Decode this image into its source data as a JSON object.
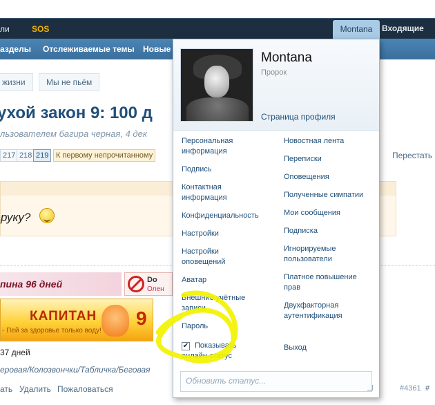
{
  "topbar": {
    "left_label": "ли",
    "sos_label": "SOS",
    "active_tab": "Montana",
    "right_tab": "Входящие"
  },
  "subnav": {
    "items": [
      "азделы",
      "Отслеживаемые темы",
      "Новые с"
    ]
  },
  "background": {
    "breadcrumbs": [
      "жизни",
      "Мы не пьём"
    ],
    "thread_title": "ухой закон 9: 100 д",
    "thread_author": "льзователем багира черная, 4 дек",
    "pages": [
      "217",
      "218",
      "219"
    ],
    "current_page": "219",
    "first_unread": "К первому непрочитанному",
    "stop_label": "Перестать",
    "box_text": "руку?",
    "days_label": "пина 96 дней",
    "noalc_text": "Do",
    "noalc_sub": "Олен",
    "banner_title": "КАПИТАН",
    "banner_sub": "- Пей за здоровье только воду!",
    "banner_num": "9",
    "days_text": "37 дней",
    "tags_text": "еровая/Колозвончки/Табличка/Беговая",
    "actions": [
      "ать",
      "Удалить",
      "Пожаловаться"
    ],
    "post_number": "#4361",
    "hash_label": "#"
  },
  "popup": {
    "username": "Montana",
    "user_title": "Пророк",
    "profile_link": "Страница профиля",
    "left_links": [
      "Персональная\nинформация",
      "Подпись",
      "Контактная\nинформация",
      "Конфиденциальность",
      "Настройки",
      "Настройки\nоповещений",
      "Аватар",
      "Внешние учётные\nзаписи",
      "Пароль"
    ],
    "right_links": [
      "Новостная лента",
      "Переписки",
      "Оповещения",
      "Полученные симпатии",
      "Мои сообщения",
      "Подписка",
      "Игнорируемые\nпользователи",
      "Платное повышение\nправ",
      "Двухфакторная\nаутентификация",
      "Выход"
    ],
    "online_status_label": "Показывать\nонлайн-статус",
    "online_status_checked": true,
    "status_placeholder": "Обновить статус..."
  },
  "annotation": {
    "marker_color": "#f2f200"
  },
  "colors": {
    "topbar": "#1d2e40",
    "subnav": "#3b6f9c",
    "link": "#1f4f7a"
  }
}
